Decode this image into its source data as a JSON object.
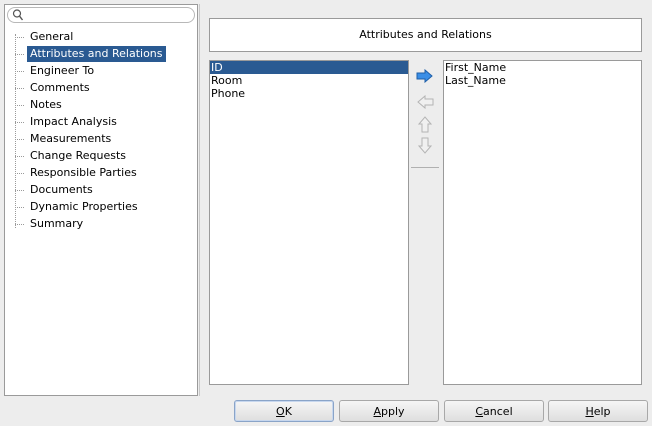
{
  "nav": {
    "search": {
      "icon": "search-icon",
      "value": ""
    },
    "items": [
      {
        "label": "General",
        "selected": false
      },
      {
        "label": "Attributes and Relations",
        "selected": true
      },
      {
        "label": "Engineer To",
        "selected": false
      },
      {
        "label": "Comments",
        "selected": false
      },
      {
        "label": "Notes",
        "selected": false
      },
      {
        "label": "Impact Analysis",
        "selected": false
      },
      {
        "label": "Measurements",
        "selected": false
      },
      {
        "label": "Change Requests",
        "selected": false
      },
      {
        "label": "Responsible Parties",
        "selected": false
      },
      {
        "label": "Documents",
        "selected": false
      },
      {
        "label": "Dynamic Properties",
        "selected": false
      },
      {
        "label": "Summary",
        "selected": false
      }
    ]
  },
  "content": {
    "title": "Attributes and Relations",
    "available": [
      "ID",
      "Room",
      "Phone"
    ],
    "available_selected": "ID",
    "selected": [
      "First_Name",
      "Last_Name"
    ],
    "move_buttons": [
      {
        "icon": "arrow-right-icon",
        "enabled": true
      },
      {
        "icon": "arrow-left-icon",
        "enabled": false
      },
      {
        "icon": "arrow-up-icon",
        "enabled": false
      },
      {
        "icon": "arrow-down-icon",
        "enabled": false
      }
    ]
  },
  "buttons": {
    "ok": {
      "mnemonic": "O",
      "rest": "K"
    },
    "apply": {
      "mnemonic": "A",
      "rest": "pply"
    },
    "cancel": {
      "mnemonic": "C",
      "rest": "ancel"
    },
    "help": {
      "mnemonic": "H",
      "rest": "elp"
    }
  },
  "colors": {
    "selection": "#2a5a92",
    "arrow_enabled": "#3a8ee6",
    "arrow_disabled": "#c8c8c8"
  }
}
